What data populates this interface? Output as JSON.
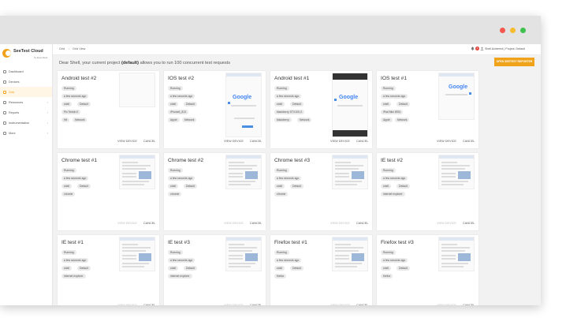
{
  "window": {
    "controls": [
      "close",
      "minimize",
      "maximize"
    ]
  },
  "sidebar": {
    "logo_text": "SeeTest Cloud",
    "logo_sub": "by Experitest",
    "items": [
      {
        "label": "Dashboard",
        "icon": "dashboard-icon",
        "active": false
      },
      {
        "label": "Devices",
        "icon": "devices-icon",
        "active": false
      },
      {
        "label": "Grid",
        "icon": "grid-icon",
        "active": true
      },
      {
        "label": "Resources",
        "icon": "resources-icon",
        "active": false,
        "chevron": "›"
      },
      {
        "label": "Reports",
        "icon": "reports-icon",
        "active": false,
        "chevron": "›"
      },
      {
        "label": "Instrumentation",
        "icon": "instrumentation-icon",
        "active": false,
        "chevron": "›"
      },
      {
        "label": "More",
        "icon": "more-icon",
        "active": false,
        "chevron": "›"
      }
    ]
  },
  "topbar": {
    "breadcrumb_1": "Grid",
    "breadcrumb_sep": "›",
    "breadcrumb_2": "Grid View",
    "notifications": "2",
    "user": "Shell Achterrot | Project: Default"
  },
  "info": {
    "prefix": "Dear Shell, your current project ",
    "project": "(default)",
    "suffix": " allows you to run 100 concurrent test requests",
    "report_button": "OPEN SEETEST REPORTER"
  },
  "actions": {
    "view": "VIEW DEVICE",
    "cancel": "CANCEL"
  },
  "cards": [
    {
      "title": "Android test #2",
      "status": "Running",
      "time": "a few seconds ago",
      "user": "shell",
      "project": "Default",
      "device": "Pix Tenkin II",
      "tags": [
        "Hit",
        "Network"
      ],
      "thumb": "blank",
      "view_enabled": true
    },
    {
      "title": "IOS test #2",
      "status": "Running",
      "time": "a few seconds ago",
      "user": "shell",
      "project": "Default",
      "device": "iPhone6_813",
      "tags": [
        "Apple",
        "Network"
      ],
      "thumb": "phone-google",
      "thumb_text": "Google",
      "view_enabled": true
    },
    {
      "title": "Android test #1",
      "status": "Running",
      "time": "a few seconds ago",
      "user": "shell",
      "project": "Default",
      "device": "blackberry STV100-3",
      "tags": [
        "blackberry",
        "Network"
      ],
      "thumb": "phone-google-dark",
      "thumb_text": "Google",
      "view_enabled": true
    },
    {
      "title": "IOS test #1",
      "status": "Running",
      "time": "a few seconds ago",
      "user": "shell",
      "project": "Default",
      "device": "iPad Mini 8931",
      "tags": [
        "Apple",
        "Network"
      ],
      "thumb": "tablet-google",
      "thumb_text": "Google",
      "view_enabled": true
    },
    {
      "title": "Chrome test #1",
      "status": "Running",
      "time": "a few seconds ago",
      "user": "shell",
      "project": "Default",
      "device": "",
      "tags": [
        "chrome"
      ],
      "thumb": "browser",
      "view_enabled": false
    },
    {
      "title": "Chrome test #2",
      "status": "Running",
      "time": "a few seconds ago",
      "user": "shell",
      "project": "Default",
      "device": "",
      "tags": [
        "chrome"
      ],
      "thumb": "browser",
      "view_enabled": false
    },
    {
      "title": "Chrome test #3",
      "status": "Running",
      "time": "a few seconds ago",
      "user": "shell",
      "project": "Default",
      "device": "",
      "tags": [
        "chrome"
      ],
      "thumb": "browser",
      "view_enabled": false
    },
    {
      "title": "IE test #2",
      "status": "Running",
      "time": "a few seconds ago",
      "user": "shell",
      "project": "Default",
      "device": "",
      "tags": [
        "internet explorer"
      ],
      "thumb": "browser",
      "view_enabled": false
    },
    {
      "title": "IE test #1",
      "status": "Running",
      "time": "a few seconds ago",
      "user": "shell",
      "project": "Default",
      "device": "",
      "tags": [
        "internet explorer"
      ],
      "thumb": "browser",
      "view_enabled": false
    },
    {
      "title": "IE test #3",
      "status": "Running",
      "time": "a few seconds ago",
      "user": "shell",
      "project": "Default",
      "device": "",
      "tags": [
        "internet explorer"
      ],
      "thumb": "browser",
      "view_enabled": false
    },
    {
      "title": "Firefox test #1",
      "status": "Running",
      "time": "a few seconds ago",
      "user": "shell",
      "project": "Default",
      "device": "",
      "tags": [
        "firefox"
      ],
      "thumb": "browser",
      "view_enabled": false
    },
    {
      "title": "Firefox test #3",
      "status": "Running",
      "time": "a few seconds ago",
      "user": "shell",
      "project": "Default",
      "device": "",
      "tags": [
        "firefox"
      ],
      "thumb": "browser",
      "view_enabled": false
    }
  ],
  "colors": {
    "accent": "#f0a21a",
    "titlebar": "#e3e3e3",
    "content_bg": "#f2f2f2",
    "badge": "#e2443a"
  }
}
